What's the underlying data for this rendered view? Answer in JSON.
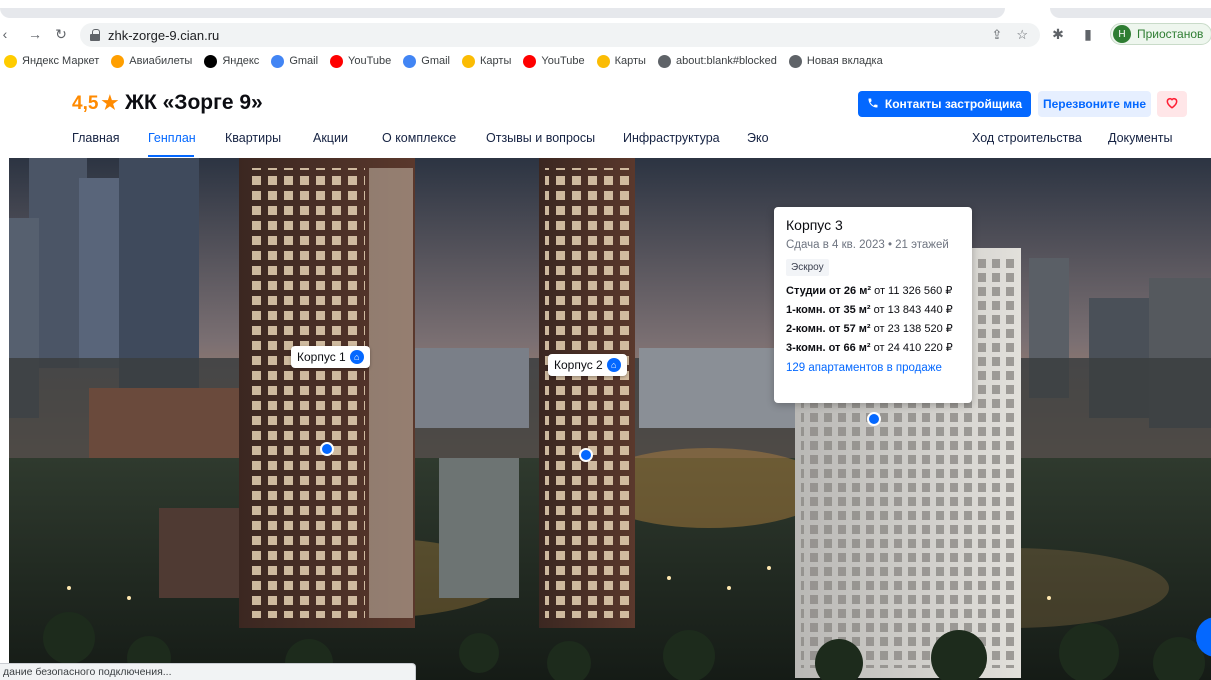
{
  "browser": {
    "url": "zhk-zorge-9.cian.ru",
    "profile_initial": "Н",
    "profile_label": "Приостанов",
    "bookmarks": [
      {
        "label": "Яндекс Маркет",
        "icon": "yandex-market-icon",
        "color": "#ffcc00"
      },
      {
        "label": "Авиабилеты",
        "icon": "avia-icon",
        "color": "#ff9f00"
      },
      {
        "label": "Яндекс",
        "icon": "yandex-icon",
        "color": "#000000"
      },
      {
        "label": "Gmail",
        "icon": "google-icon",
        "color": "#4285f4"
      },
      {
        "label": "YouTube",
        "icon": "youtube-icon",
        "color": "#ff0000"
      },
      {
        "label": "Gmail",
        "icon": "google-icon",
        "color": "#4285f4"
      },
      {
        "label": "Карты",
        "icon": "maps-pin-icon",
        "color": "#fbbc04"
      },
      {
        "label": "YouTube",
        "icon": "youtube-icon",
        "color": "#ff0000"
      },
      {
        "label": "Карты",
        "icon": "maps-pin-icon",
        "color": "#fbbc04"
      },
      {
        "label": "about:blank#blocked",
        "icon": "globe-icon",
        "color": "#5f6368"
      },
      {
        "label": "Новая вкладка",
        "icon": "globe-icon",
        "color": "#5f6368"
      }
    ],
    "status_text": "дание безопасного подключения..."
  },
  "site": {
    "rating": "4,5",
    "title": "ЖК «Зорге 9»",
    "contact_button": "Контакты застройщика",
    "callback_button": "Перезвоните мне",
    "menu": [
      {
        "label": "Главная",
        "active": false
      },
      {
        "label": "Генплан",
        "active": true
      },
      {
        "label": "Квартиры",
        "active": false
      },
      {
        "label": "Акции",
        "active": false
      },
      {
        "label": "О комплексе",
        "active": false
      },
      {
        "label": "Отзывы и вопросы",
        "active": false
      },
      {
        "label": "Инфраструктура",
        "active": false
      },
      {
        "label": "Эко",
        "active": false
      },
      {
        "label": "Ход строительства",
        "active": false
      },
      {
        "label": "Документы",
        "active": false
      }
    ],
    "accent": "#0468ff"
  },
  "genplan": {
    "buildings": [
      {
        "label": "Корпус 1"
      },
      {
        "label": "Корпус 2"
      }
    ],
    "popup": {
      "title": "Корпус 3",
      "subtitle": "Сдача в 4 кв. 2023 • 21 этажей",
      "badge": "Эскроу",
      "rows": [
        {
          "type": "Студии от 26 м²",
          "price": "от 11 326 560 ₽"
        },
        {
          "type": "1-комн. от 35 м²",
          "price": "от 13 843 440 ₽"
        },
        {
          "type": "2-комн. от 57 м²",
          "price": "от 23 138 520 ₽"
        },
        {
          "type": "3-комн. от 66 м²",
          "price": "от 24 410 220 ₽"
        }
      ],
      "link": "129 апартаментов в продаже"
    }
  }
}
